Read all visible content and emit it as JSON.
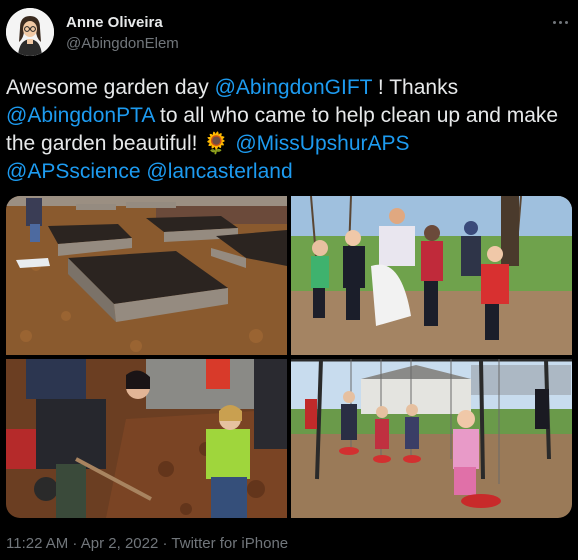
{
  "author": {
    "name": "Anne Oliveira",
    "handle": "@AbingdonElem"
  },
  "tweet": {
    "text_1": "Awesome garden day ",
    "mention_1": "@AbingdonGIFT",
    "text_2": " ! Thanks ",
    "mention_2": "@AbingdonPTA",
    "text_3": " to all who came to help clean up and make the garden beautiful! ",
    "emoji": "🌻",
    "text_4": " ",
    "mention_3": "@MissUpshurAPS",
    "mention_4": "@APSscience",
    "text_5": " ",
    "mention_5": "@lancasterland"
  },
  "meta": {
    "time": "11:22 AM",
    "separator": " · ",
    "date": "Apr 2, 2022",
    "source": "Twitter for iPhone"
  },
  "colors": {
    "background": "#000000",
    "text": "#e7e9ea",
    "secondary": "#71767b",
    "link": "#1d9bf0"
  },
  "photos": [
    {
      "subject": "raised-garden-beds-with-mulch"
    },
    {
      "subject": "children-collecting-leaves"
    },
    {
      "subject": "volunteers-shoveling-mulch"
    },
    {
      "subject": "children-on-playground"
    }
  ]
}
